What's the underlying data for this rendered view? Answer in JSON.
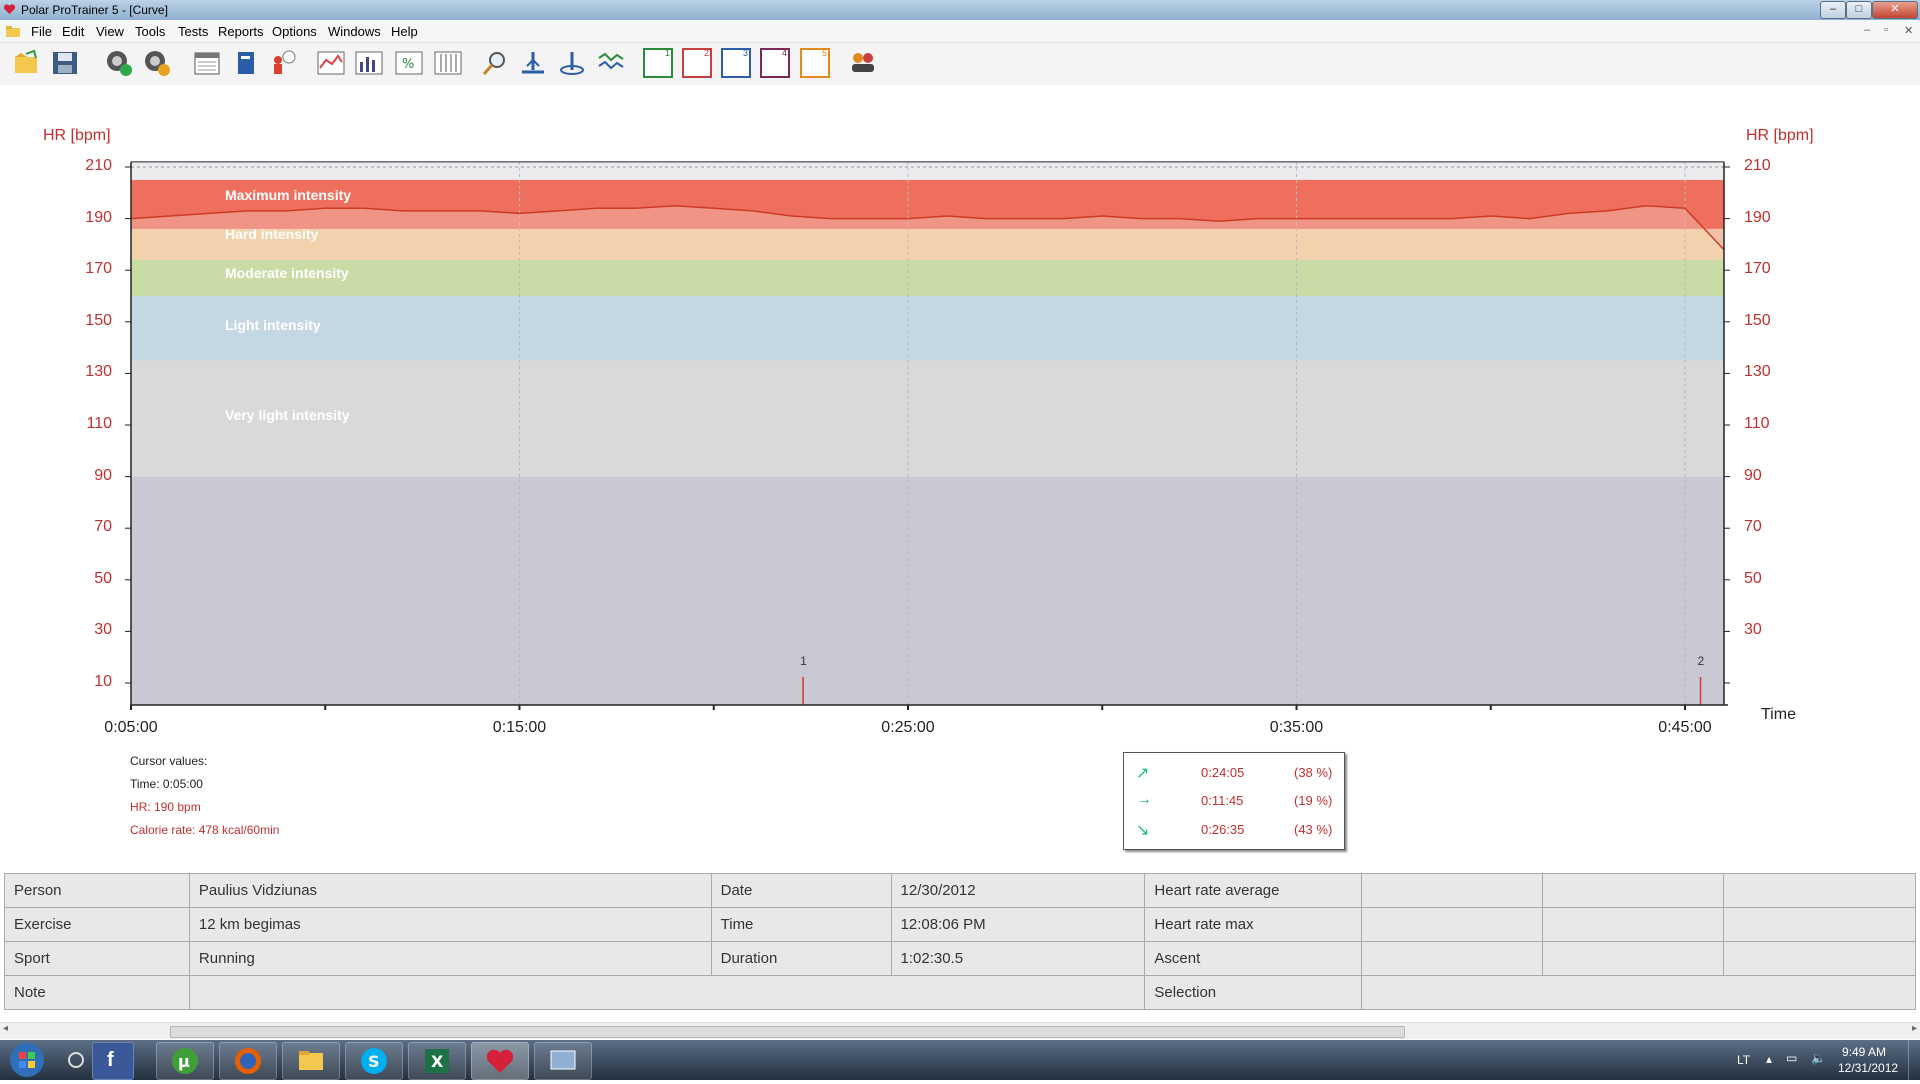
{
  "window": {
    "title": "Polar ProTrainer 5 - [Curve]"
  },
  "menu": [
    "File",
    "Edit",
    "View",
    "Tools",
    "Tests",
    "Reports",
    "Options",
    "Windows",
    "Help"
  ],
  "toolbar_icons": [
    "open-folder-icon",
    "save-icon",
    "sync-icon",
    "settings-icon",
    "calendar-icon",
    "book-icon",
    "person-weight-icon",
    "line-graph-icon",
    "bar-graph-icon",
    "percent-grid-icon",
    "table-icon",
    "zoom-icon",
    "measure-icon",
    "target-icon",
    "multi-line-icon",
    "curve1-icon",
    "curve2-icon",
    "curve3-icon",
    "curve4-icon",
    "curve5-icon",
    "users-icon"
  ],
  "toolbar_curve_labels": [
    "1",
    "2",
    "3",
    "4",
    "5"
  ],
  "chart_data": {
    "type": "area",
    "ylabel_left": "HR [bpm]",
    "ylabel_right": "HR [bpm]",
    "xlabel": "Time",
    "ylim": [
      0,
      212
    ],
    "yticks": [
      210,
      190,
      170,
      150,
      130,
      110,
      90,
      70,
      50,
      30,
      10
    ],
    "xtick_labels": [
      "0:05:00",
      "0:15:00",
      "0:25:00",
      "0:35:00",
      "0:45:00"
    ],
    "x_range_minutes": [
      5,
      46
    ],
    "zones": [
      {
        "name": "Maximum intensity",
        "min": 186,
        "max": 205,
        "color": "#ee6f5d"
      },
      {
        "name": "Hard intensity",
        "min": 174,
        "max": 186,
        "color": "#f1d2ac"
      },
      {
        "name": "Moderate intensity",
        "min": 160,
        "max": 174,
        "color": "#cadca6"
      },
      {
        "name": "Light intensity",
        "min": 135,
        "max": 160,
        "color": "#c4d8e4"
      },
      {
        "name": "Very light intensity",
        "min": 90,
        "max": 135,
        "color": "#d9d9d9"
      }
    ],
    "below_zone_color": "#c9c9d4",
    "series": [
      {
        "x_minutes": [
          5,
          6,
          7,
          8,
          9,
          10,
          11,
          12,
          13,
          14,
          15,
          16,
          17,
          18,
          19,
          20,
          21,
          22,
          23,
          24,
          25,
          26,
          27,
          28,
          29,
          30,
          31,
          32,
          33,
          34,
          35,
          36,
          37,
          38,
          39,
          40,
          41,
          42,
          43,
          44,
          45,
          45.5,
          46
        ],
        "hr": [
          190,
          191,
          192,
          193,
          193,
          194,
          194,
          193,
          193,
          193,
          192,
          193,
          194,
          194,
          195,
          194,
          193,
          191,
          190,
          190,
          190,
          191,
          190,
          190,
          190,
          191,
          190,
          190,
          189,
          190,
          190,
          190,
          190,
          190,
          190,
          191,
          190,
          192,
          193,
          195,
          194,
          186,
          178
        ]
      }
    ],
    "laps": [
      {
        "label": "1",
        "x_minutes": 22.3
      },
      {
        "label": "2",
        "x_minutes": 45.4
      }
    ]
  },
  "cursor_values": {
    "heading": "Cursor values:",
    "time": "Time: 0:05:00",
    "hr": "HR: 190 bpm",
    "calorie": "Calorie rate: 478 kcal/60min"
  },
  "summary": [
    {
      "icon": "↗",
      "time": "0:24:05",
      "pct": "(38 %)"
    },
    {
      "icon": "→",
      "time": "0:11:45",
      "pct": "(19 %)"
    },
    {
      "icon": "↘",
      "time": "0:26:35",
      "pct": "(43 %)"
    }
  ],
  "info": {
    "person_label": "Person",
    "person": "Paulius Vidziunas",
    "exercise_label": "Exercise",
    "exercise": "12 km begimas",
    "sport_label": "Sport",
    "sport": "Running",
    "note_label": "Note",
    "date_label": "Date",
    "date": "12/30/2012",
    "time_label": "Time",
    "time": "12:08:06 PM",
    "duration_label": "Duration",
    "duration": "1:02:30.5",
    "hr_avg_label": "Heart rate average",
    "hr_max_label": "Heart rate max",
    "ascent_label": "Ascent",
    "selection_label": "Selection"
  },
  "taskbar": {
    "apps": [
      "windows-start-icon",
      "recycle-icon",
      "facebook-icon",
      "utorrent-icon",
      "firefox-icon",
      "explorer-icon",
      "skype-icon",
      "excel-icon",
      "polar-heart-icon",
      "desktop-icon"
    ],
    "lang": "LT",
    "clock_time": "9:49 AM",
    "clock_date": "12/31/2012"
  },
  "colors": {
    "accent": "#c03030",
    "zone_line": "#cc3b26"
  }
}
